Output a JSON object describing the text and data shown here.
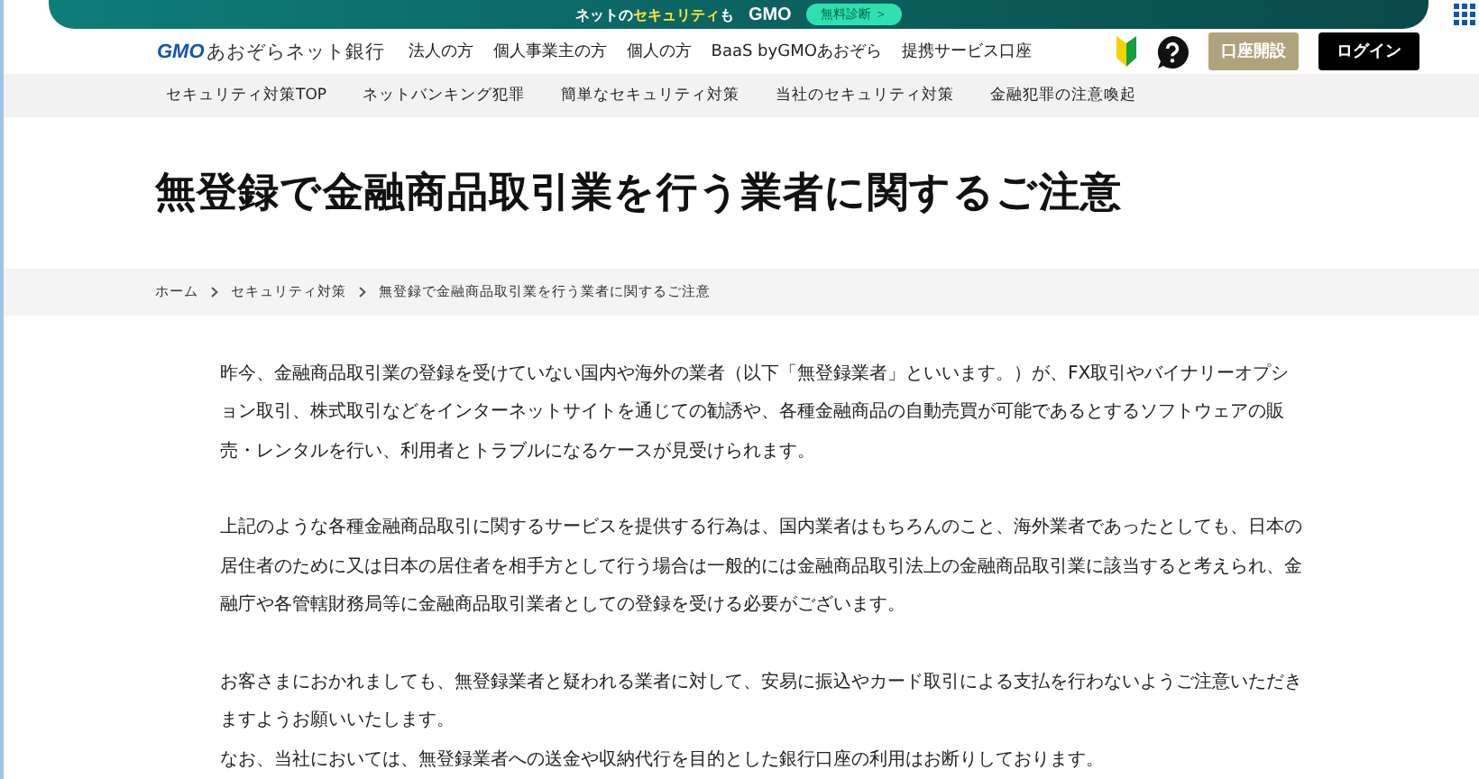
{
  "banner": {
    "text": "ネットの**セキュリティ**も",
    "logo": "GMO",
    "button": "無料診断 ＞"
  },
  "header": {
    "logo_mark": "GMO",
    "logo_text": "あおぞらネット銀行",
    "links": [
      "法人の方",
      "個人事業主の方",
      "個人の方",
      "BaaS byGMOあおぞら",
      "提携サービス口座"
    ],
    "open_account": "口座開設",
    "login": "ログイン"
  },
  "subnav": [
    "セキュリティ対策TOP",
    "ネットバンキング犯罪",
    "簡単なセキュリティ対策",
    "当社のセキュリティ対策",
    "金融犯罪の注意喚起"
  ],
  "title": "無登録で金融商品取引業を行う業者に関するご注意",
  "breadcrumb": [
    "ホーム",
    "セキュリティ対策",
    "無登録で金融商品取引業を行う業者に関するご注意"
  ],
  "paragraphs": [
    [
      "昨今、金融商品取引業の登録を受けていない国内や海外の業者（以下「無登録業者」といいます。）が、FX取引やバイナリーオプション取引、株式取引などをインターネットサイトを通じての勧誘や、各種金融商品の自動売買が可能であるとするソフトウェアの販売・レンタルを行い、利用者とトラブルになるケースが見受けられます。"
    ],
    [
      "上記のような各種金融商品取引に関するサービスを提供する行為は、国内業者はもちろんのこと、海外業者であったとしても、日本の居住者のために又は日本の居住者を相手方として行う場合は一般的には金融商品取引法上の金融商品取引業に該当すると考えられ、金融庁や各管轄財務局等に金融商品取引業者としての登録を受ける必要がございます。"
    ],
    [
      "お客さまにおかれましても、無登録業者と疑われる業者に対して、安易に振込やカード取引による支払を行わないようご注意いただきますようお願いいたします。",
      "なお、当社においては、無登録業者への送金や収納代行を目的とした銀行口座の利用はお断りしております。"
    ]
  ]
}
